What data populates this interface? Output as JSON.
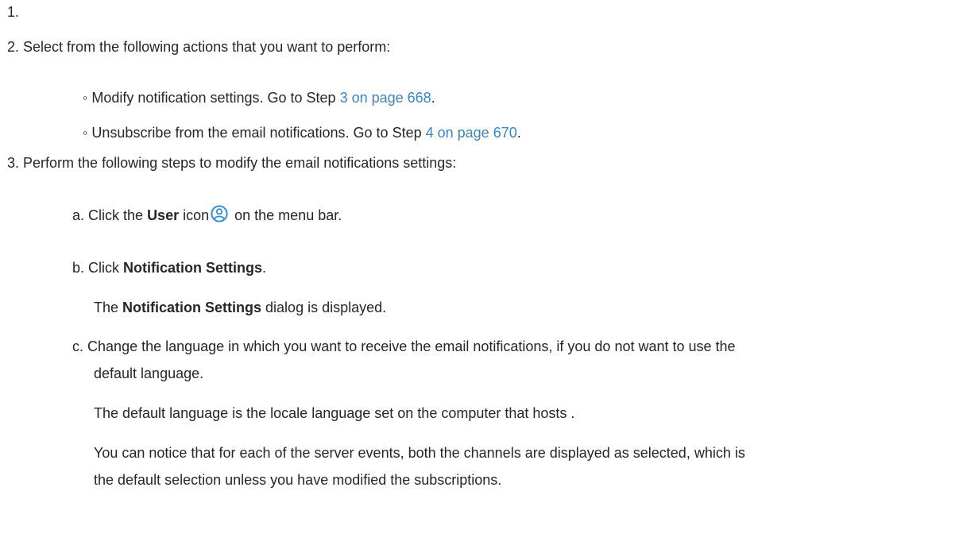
{
  "steps": {
    "s1": {
      "num": "1."
    },
    "s2": {
      "num": "2.",
      "text": "Select from the following actions that you want to perform:",
      "bullets": [
        {
          "marker": "◦",
          "before": "Modify notification settings. Go to Step ",
          "link": "3 on page 668",
          "after": "."
        },
        {
          "marker": "◦",
          "before": "Unsubscribe from the email notifications. Go to Step ",
          "link": "4 on page 670",
          "after": "."
        }
      ]
    },
    "s3": {
      "num": "3.",
      "text": "Perform the following steps to modify the email notifications settings:",
      "a": {
        "letter": "a.",
        "pre": "Click the ",
        "bold": "User",
        "mid": " icon",
        "post": " on the menu bar.",
        "icon": "user-circle-icon"
      },
      "b": {
        "letter": "b.",
        "pre": "Click ",
        "bold": "Notification Settings",
        "post": ".",
        "result_pre": "The ",
        "result_bold": "Notification Settings",
        "result_post": " dialog is displayed."
      },
      "c": {
        "letter": "c.",
        "line1": "Change the language in which you want to receive the email notifications, if you do not want to use the",
        "line2": "default language.",
        "para1": "The default language is the locale language set on the computer that hosts .",
        "para2_line1": "You can notice that for each of the server events, both the channels are displayed as selected, which is",
        "para2_line2": "the default selection unless you have modified the subscriptions."
      }
    }
  },
  "colors": {
    "text": "#262626",
    "link": "#3a84c4",
    "icon": "#2f8fd6"
  }
}
